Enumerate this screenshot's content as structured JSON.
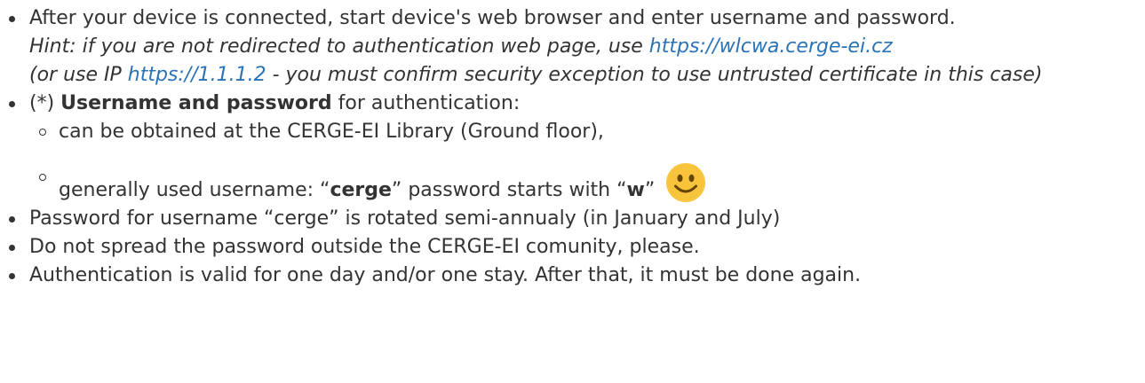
{
  "items": [
    {
      "text": "After your device is connected, start device's web browser and enter username and password.",
      "hint_prefix": "Hint: if you are not redirected to authentication web page, use ",
      "hint_link1": "https://wlcwa.cerge-ei.cz",
      "hint_mid": "(or use IP ",
      "hint_link2": "https://1.1.1.2",
      "hint_suffix": " - you must confirm security exception to use untrusted certificate in this case)"
    },
    {
      "prefix": "(*) ",
      "bold": "Username and password",
      "suffix": " for authentication:",
      "sub": [
        {
          "text": "can be obtained at the CERGE-EI Library (Ground floor),"
        },
        {
          "text1": "generally used username: “",
          "bold1": "cerge",
          "text2": "” password starts with “",
          "bold2": "w",
          "text3": "”",
          "emoji": "smiley-face-icon"
        }
      ]
    },
    {
      "text": "Password for username “cerge” is rotated semi-annualy (in January and July)"
    },
    {
      "text": "Do not spread the password outside the CERGE-EI comunity, please."
    },
    {
      "text": "Authentication is valid for one day and/or one stay. After that, it must be done again."
    }
  ],
  "colors": {
    "text": "#333333",
    "link": "#2b73b7",
    "emoji_face": "#f8c43c",
    "emoji_features": "#664500"
  }
}
